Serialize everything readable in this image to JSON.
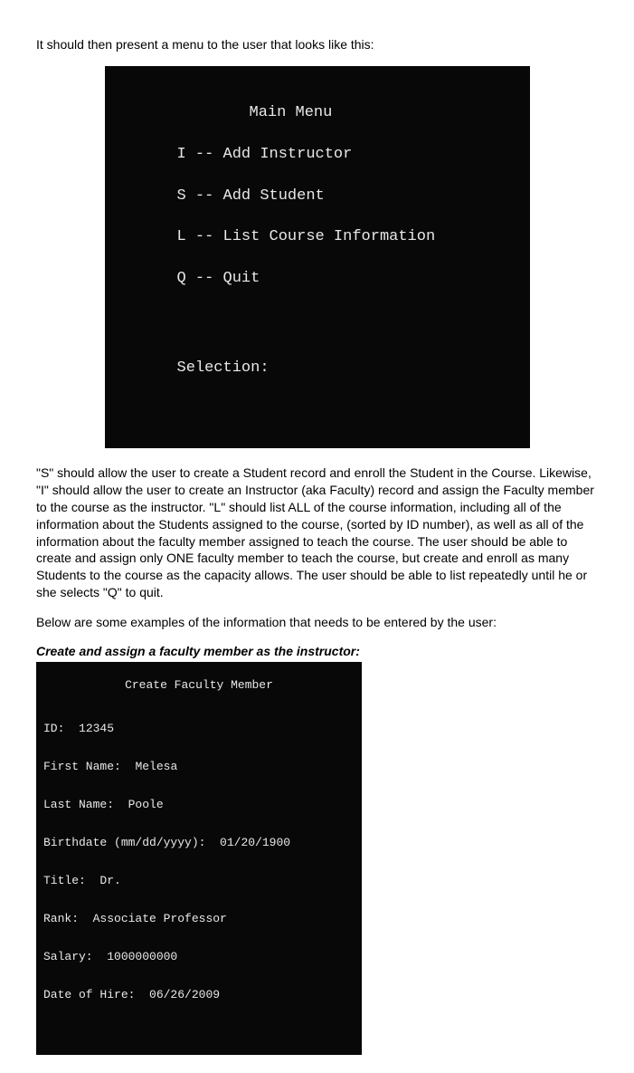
{
  "intro_text": "It should then present a menu to the user that looks like this:",
  "menu": {
    "title": "Main Menu",
    "items": [
      {
        "key": "I",
        "label": "Add Instructor"
      },
      {
        "key": "S",
        "label": "Add Student"
      },
      {
        "key": "L",
        "label": "List Course Information"
      },
      {
        "key": "Q",
        "label": "Quit"
      }
    ],
    "prompt": "Selection:"
  },
  "explanation": "\"S\" should allow the user to create a Student record and enroll the Student in the Course.  Likewise, \"I\" should allow the user to create an Instructor (aka Faculty) record and assign the Faculty member to the course as the instructor.  \"L\" should list ALL of the course information, including all of the information about the Students assigned to the course, (sorted by ID number), as well as all of the information about the faculty member assigned to teach the course.  The user should be able to create and assign only ONE faculty member to teach the course, but create and enroll as many Students to the course as the capacity allows.  The user should be able to list repeatedly until he or she selects \"Q\" to quit.",
  "examples_intro": "Below are some examples of the information that needs to be entered by the user:",
  "faculty_heading": "Create and assign a faculty member as the instructor:",
  "faculty_form": {
    "title": "Create Faculty Member",
    "fields": [
      {
        "label": "ID:",
        "value": "12345"
      },
      {
        "label": "First Name:",
        "value": "Melesa"
      },
      {
        "label": "Last Name:",
        "value": "Poole"
      },
      {
        "label": "Birthdate (mm/dd/yyyy):",
        "value": "01/20/1900"
      },
      {
        "label": "Title:",
        "value": "Dr."
      },
      {
        "label": "Rank:",
        "value": "Associate Professor"
      },
      {
        "label": "Salary:",
        "value": "1000000000"
      },
      {
        "label": "Date of Hire:",
        "value": "06/26/2009"
      }
    ]
  }
}
